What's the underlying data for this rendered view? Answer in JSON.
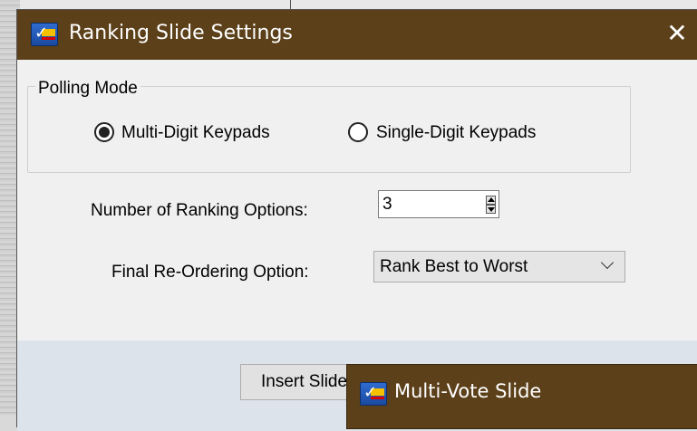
{
  "dialog": {
    "title": "Ranking Slide Settings",
    "close_glyph": "✕",
    "icon": "app-logo-icon"
  },
  "polling_mode": {
    "legend": "Polling Mode",
    "options": [
      {
        "label": "Multi-Digit Keypads",
        "selected": true
      },
      {
        "label": "Single-Digit Keypads",
        "selected": false
      }
    ]
  },
  "ranking_options": {
    "label": "Number of Ranking Options:",
    "value": "3"
  },
  "reorder": {
    "label": "Final Re-Ordering Option:",
    "selected": "Rank Best to Worst"
  },
  "footer": {
    "insert_label": "Insert Slide"
  },
  "second_dialog": {
    "title": "Multi-Vote Slide"
  }
}
